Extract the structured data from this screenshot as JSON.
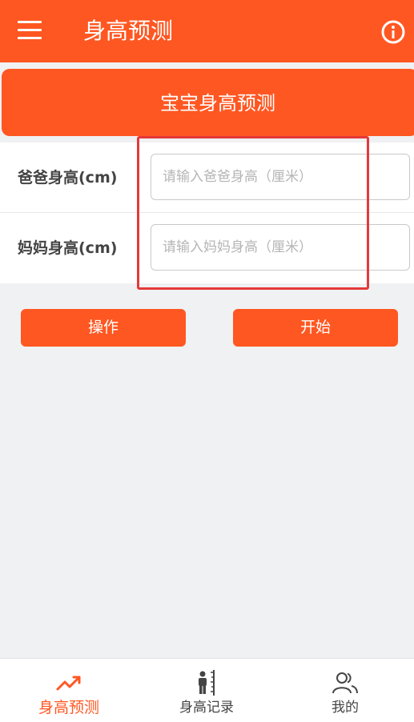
{
  "appbar": {
    "title": "身高预测",
    "menu_icon": "menu-icon",
    "info_icon": "info-icon"
  },
  "banner": {
    "title": "宝宝身高预测"
  },
  "form": {
    "father": {
      "label": "爸爸身高(cm)",
      "value": "",
      "placeholder": "请输入爸爸身高（厘米）"
    },
    "mother": {
      "label": "妈妈身高(cm)",
      "value": "",
      "placeholder": "请输入妈妈身高（厘米）"
    }
  },
  "actions": {
    "operate_label": "操作",
    "start_label": "开始"
  },
  "tabs": [
    {
      "label": "身高预测",
      "icon": "trend-up-icon",
      "active": true
    },
    {
      "label": "身高记录",
      "icon": "height-measure-icon",
      "active": false
    },
    {
      "label": "我的",
      "icon": "users-icon",
      "active": false
    }
  ],
  "colors": {
    "primary": "#ff5722",
    "highlight": "#e53939",
    "background": "#f0f1f3"
  }
}
